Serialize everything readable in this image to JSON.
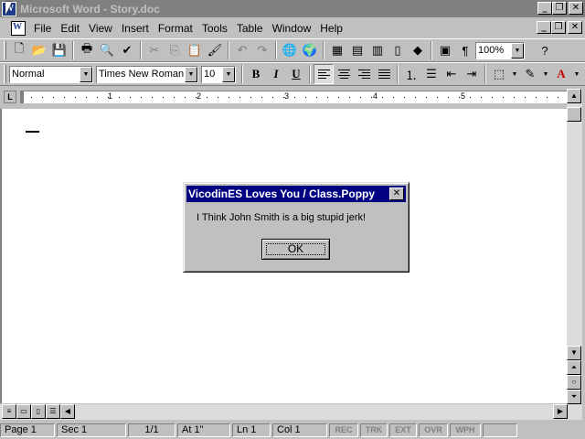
{
  "window": {
    "title": "Microsoft Word - Story.doc",
    "minimize": "_",
    "restore": "❐",
    "close": "✕"
  },
  "menu": {
    "items": [
      "File",
      "Edit",
      "View",
      "Insert",
      "Format",
      "Tools",
      "Table",
      "Window",
      "Help"
    ]
  },
  "standard_toolbar": {
    "zoom": "100%",
    "icons": [
      "new-icon",
      "open-icon",
      "save-icon",
      "print-icon",
      "print-preview-icon",
      "spelling-icon",
      "cut-icon",
      "copy-icon",
      "paste-icon",
      "format-painter-icon",
      "undo-icon",
      "redo-icon",
      "insert-hyperlink-icon",
      "web-toolbar-icon",
      "tables-borders-icon",
      "insert-table-icon",
      "insert-excel-icon",
      "columns-icon",
      "drawing-icon",
      "document-map-icon",
      "show-hide-icon",
      "help-icon"
    ]
  },
  "formatting_toolbar": {
    "style": "Normal",
    "font": "Times New Roman",
    "size": "10",
    "bold": "B",
    "italic": "I",
    "underline": "U"
  },
  "ruler": {
    "numbers": [
      "1",
      "2",
      "3",
      "4",
      "5"
    ]
  },
  "dialog": {
    "title": "VicodinES Loves You / Class.Poppy",
    "message": "I Think John Smith is a big stupid jerk!",
    "ok_label": "OK",
    "close": "✕"
  },
  "status_bar": {
    "page": "Page 1",
    "sec": "Sec 1",
    "pages": "1/1",
    "at": "At 1\"",
    "ln": "Ln 1",
    "col": "Col 1",
    "rec": "REC",
    "trk": "TRK",
    "ext": "EXT",
    "ovr": "OVR",
    "wph": "WPH"
  },
  "colors": {
    "inactive_titlebar": "#808080",
    "dialog_titlebar": "#000080",
    "chrome": "#c0c0c0"
  }
}
